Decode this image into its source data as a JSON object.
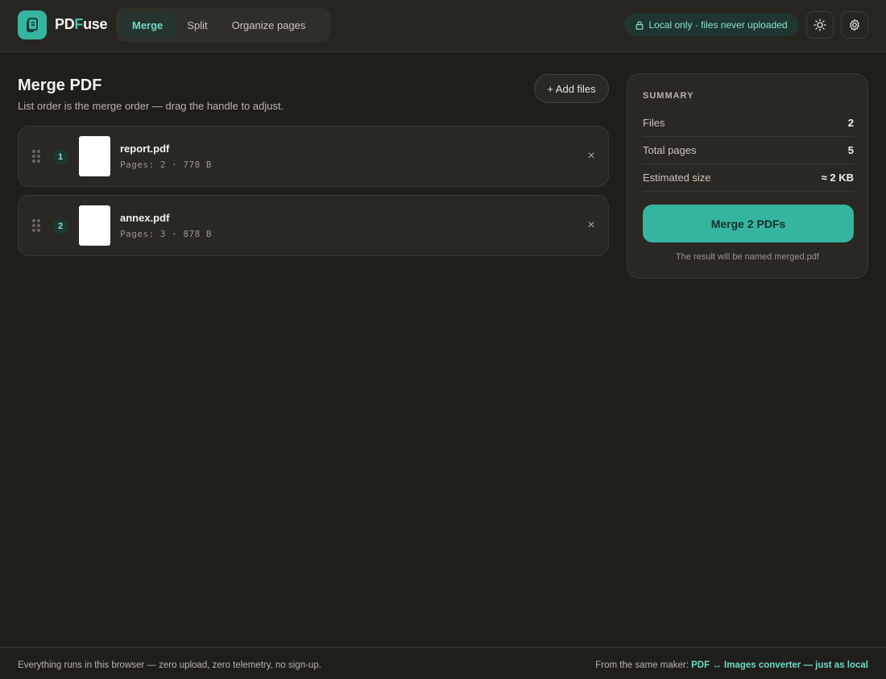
{
  "app": {
    "brand_pre": "PD",
    "brand_accent": "F",
    "brand_post": "use",
    "accent_color": "#35b5a0"
  },
  "nav": {
    "tabs": [
      {
        "label": "Merge",
        "active": true
      },
      {
        "label": "Split",
        "active": false
      },
      {
        "label": "Organize pages",
        "active": false
      }
    ]
  },
  "header": {
    "local_badge": "Local only · files never uploaded",
    "theme_icon": "sun-icon",
    "settings_icon": "gear-icon"
  },
  "main": {
    "title": "Merge PDF",
    "subtitle": "List order is the merge order — drag the handle to adjust.",
    "add_files_label": "+ Add files",
    "files": [
      {
        "index": "1",
        "name": "report.pdf",
        "meta": "Pages: 2 · 778 B"
      },
      {
        "index": "2",
        "name": "annex.pdf",
        "meta": "Pages: 3 · 878 B"
      }
    ]
  },
  "summary": {
    "title": "SUMMARY",
    "rows": [
      {
        "label": "Files",
        "value": "2"
      },
      {
        "label": "Total pages",
        "value": "5"
      },
      {
        "label": "Estimated size",
        "value": "≈ 2 KB"
      }
    ],
    "merge_button": "Merge 2 PDFs",
    "result_note": "The result will be named merged.pdf"
  },
  "footer": {
    "left": "Everything runs in this browser — zero upload, zero telemetry, no sign-up.",
    "right_prefix": "From the same maker: ",
    "right_link": "PDF ↔ Images converter — just as local"
  }
}
